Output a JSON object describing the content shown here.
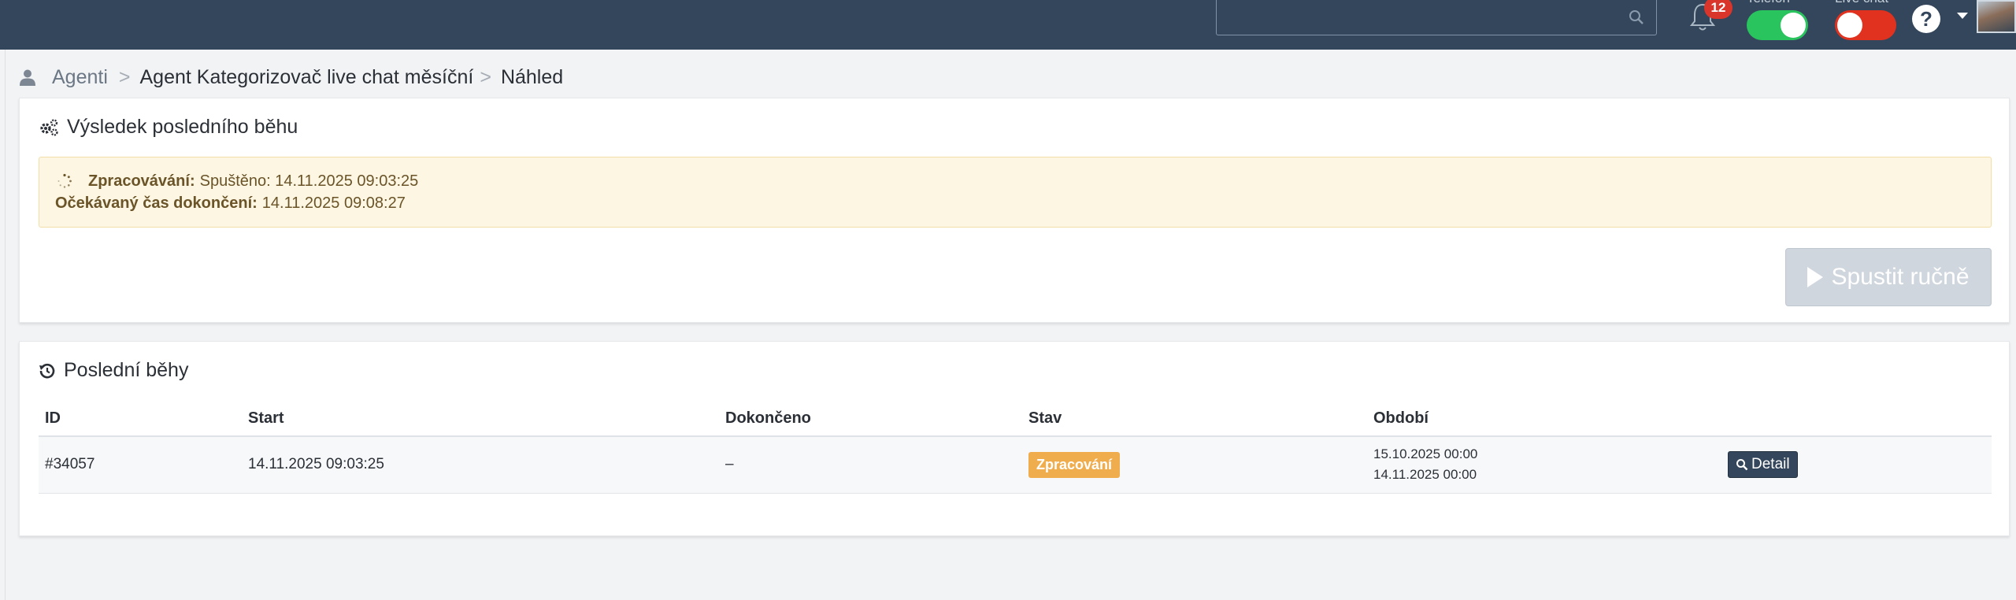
{
  "topbar": {
    "notification_count": "12",
    "toggles": [
      {
        "label": "Telefon",
        "state": "on",
        "color": "#2ac45e"
      },
      {
        "label": "Live chat",
        "state": "off",
        "color": "#e0321f"
      }
    ],
    "help_label": "?",
    "bar_color": "#34465b"
  },
  "breadcrumb": {
    "items": [
      "Agenti",
      "Agent Kategorizovač live chat měsíční",
      "Náhled"
    ],
    "separator": ">"
  },
  "last_run": {
    "title": "Výsledek posledního běhu",
    "alert": {
      "processing_label": "Zpracovávání:",
      "processing_value": "Spuštěno: 14.11.2025 09:03:25",
      "eta_label": "Očekávaný čas dokončení:",
      "eta_value": "14.11.2025 09:08:27"
    },
    "run_button_label": "Spustit ručně"
  },
  "recent_runs": {
    "title": "Poslední běhy",
    "columns": [
      "ID",
      "Start",
      "Dokončeno",
      "Stav",
      "Období",
      ""
    ],
    "rows": [
      {
        "id": "#34057",
        "start": "14.11.2025 09:03:25",
        "finished": "–",
        "status": "Zpracování",
        "period_from": "15.10.2025 00:00",
        "period_to": "14.11.2025 00:00",
        "action": "Detail"
      }
    ]
  }
}
